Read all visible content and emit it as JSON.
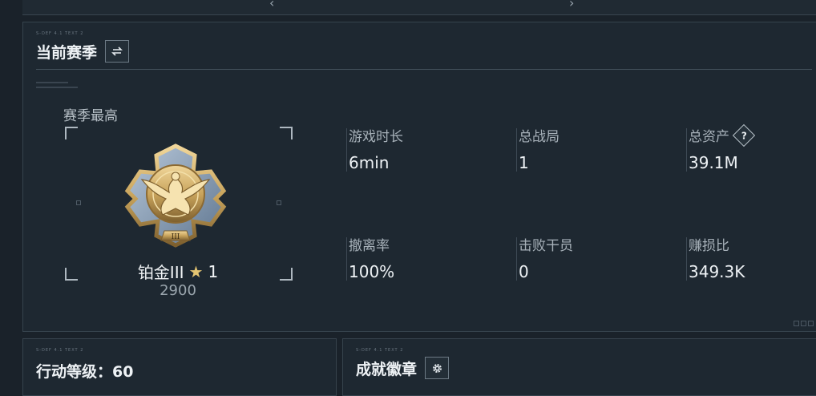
{
  "main": {
    "title": "当前赛季",
    "switch_icon": "swap-icon",
    "tiny_code": "S-DEF 4.1 TEXT 2",
    "season_best_label": "赛季最高",
    "rank": {
      "name": "铂金III",
      "stars": "1",
      "score": "2900",
      "star_color": "#e4c572"
    },
    "stats": [
      {
        "label": "游戏时长",
        "value": "6min"
      },
      {
        "label": "总战局",
        "value": "1"
      },
      {
        "label": "总资产",
        "value": "39.1M",
        "help": "?"
      },
      {
        "label": "撤离率",
        "value": "100%"
      },
      {
        "label": "击败干员",
        "value": "0"
      },
      {
        "label": "赚损比",
        "value": "349.3K"
      }
    ]
  },
  "bottom_left": {
    "tiny_code": "S-DEF 4.1 TEXT 2",
    "title": "行动等级：60"
  },
  "bottom_right": {
    "tiny_code": "S-DEF 4.1 TEXT 2",
    "title": "成就徽章",
    "settings_icon": "gear-icon"
  },
  "colors": {
    "background": "#1a222a",
    "panel": "#1e2831",
    "border": "#36434d",
    "medal_gold": "#c9a45c",
    "medal_blue": "#8a9fb6"
  }
}
